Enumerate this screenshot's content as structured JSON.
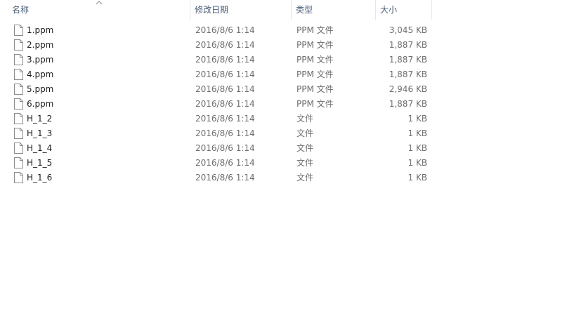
{
  "columns": {
    "name": "名称",
    "date": "修改日期",
    "type": "类型",
    "size": "大小"
  },
  "sort": {
    "column": "name",
    "icon": "chevron-up-icon"
  },
  "files": [
    {
      "name": "1.ppm",
      "date": "2016/8/6 1:14",
      "type": "PPM 文件",
      "size": "3,045 KB",
      "icon": "file-icon"
    },
    {
      "name": "2.ppm",
      "date": "2016/8/6 1:14",
      "type": "PPM 文件",
      "size": "1,887 KB",
      "icon": "file-icon"
    },
    {
      "name": "3.ppm",
      "date": "2016/8/6 1:14",
      "type": "PPM 文件",
      "size": "1,887 KB",
      "icon": "file-icon"
    },
    {
      "name": "4.ppm",
      "date": "2016/8/6 1:14",
      "type": "PPM 文件",
      "size": "1,887 KB",
      "icon": "file-icon"
    },
    {
      "name": "5.ppm",
      "date": "2016/8/6 1:14",
      "type": "PPM 文件",
      "size": "2,946 KB",
      "icon": "file-icon"
    },
    {
      "name": "6.ppm",
      "date": "2016/8/6 1:14",
      "type": "PPM 文件",
      "size": "1,887 KB",
      "icon": "file-icon"
    },
    {
      "name": "H_1_2",
      "date": "2016/8/6 1:14",
      "type": "文件",
      "size": "1 KB",
      "icon": "file-icon"
    },
    {
      "name": "H_1_3",
      "date": "2016/8/6 1:14",
      "type": "文件",
      "size": "1 KB",
      "icon": "file-icon"
    },
    {
      "name": "H_1_4",
      "date": "2016/8/6 1:14",
      "type": "文件",
      "size": "1 KB",
      "icon": "file-icon"
    },
    {
      "name": "H_1_5",
      "date": "2016/8/6 1:14",
      "type": "文件",
      "size": "1 KB",
      "icon": "file-icon"
    },
    {
      "name": "H_1_6",
      "date": "2016/8/6 1:14",
      "type": "文件",
      "size": "1 KB",
      "icon": "file-icon"
    }
  ]
}
